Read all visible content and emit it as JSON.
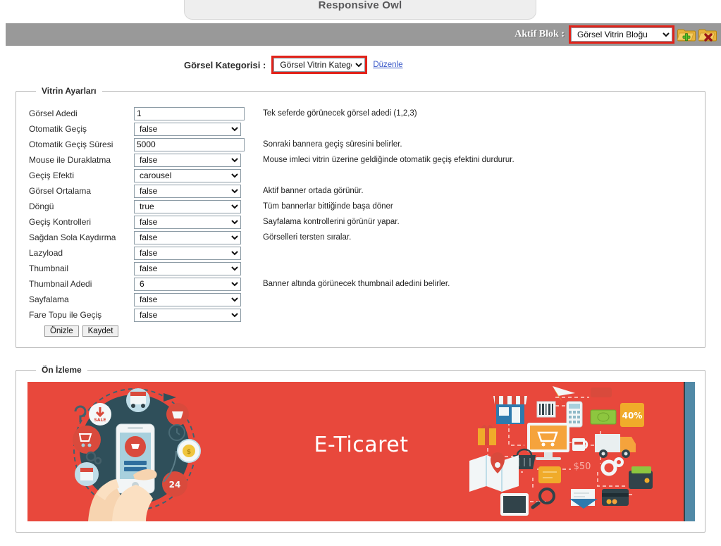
{
  "header": {
    "title": "Responsive Owl"
  },
  "toolbar": {
    "active_block_label": "Aktif Blok :",
    "active_block_value": "Görsel Vitrin Bloğu",
    "add_icon": "folder-add-icon",
    "delete_icon": "folder-delete-icon"
  },
  "category": {
    "label": "Görsel Kategorisi :",
    "value": "Görsel Vitrin Kategori",
    "edit_link": "Düzenle"
  },
  "settings": {
    "legend": "Vitrin Ayarları",
    "rows": [
      {
        "label": "Görsel Adedi",
        "type": "text",
        "value": "1",
        "desc": "Tek seferde görünecek görsel adedi (1,2,3)"
      },
      {
        "label": "Otomatik Geçiş",
        "type": "select",
        "value": "false",
        "desc": ""
      },
      {
        "label": "Otomatik Geçiş Süresi",
        "type": "text",
        "value": "5000",
        "desc": "Sonraki bannera geçiş süresini belirler."
      },
      {
        "label": "Mouse ile Duraklatma",
        "type": "select",
        "value": "false",
        "desc": "Mouse imleci vitrin üzerine geldiğinde otomatik geçiş efektini durdurur."
      },
      {
        "label": "Geçiş Efekti",
        "type": "select",
        "value": "carousel",
        "desc": ""
      },
      {
        "label": "Görsel Ortalama",
        "type": "select",
        "value": "false",
        "desc": "Aktif banner ortada görünür."
      },
      {
        "label": "Döngü",
        "type": "select",
        "value": "true",
        "desc": "Tüm bannerlar bittiğinde başa döner"
      },
      {
        "label": "Geçiş Kontrolleri",
        "type": "select",
        "value": "false",
        "desc": "Sayfalama kontrollerini görünür yapar."
      },
      {
        "label": "Sağdan Sola Kaydırma",
        "type": "select",
        "value": "false",
        "desc": "Görselleri tersten sıralar."
      },
      {
        "label": "Lazyload",
        "type": "select",
        "value": "false",
        "desc": ""
      },
      {
        "label": "Thumbnail",
        "type": "select",
        "value": "false",
        "desc": ""
      },
      {
        "label": "Thumbnail Adedi",
        "type": "select",
        "value": "6",
        "desc": "Banner altında görünecek thumbnail adedini belirler."
      },
      {
        "label": "Sayfalama",
        "type": "select",
        "value": "false",
        "desc": ""
      },
      {
        "label": "Fare Topu ile Geçiş",
        "type": "select",
        "value": "false",
        "desc": ""
      }
    ],
    "preview_button": "Önizle",
    "save_button": "Kaydet"
  },
  "preview": {
    "legend": "Ön İzleme",
    "banner_title": "E-Ticaret",
    "banner_bg": "#e8483c",
    "banner_edge": "#5189a6",
    "discount_badge": "40%",
    "price_tag": "$50",
    "sale_badge": "SALE",
    "hours_badge": "24"
  },
  "colors": {
    "toolbar_bg": "#999999",
    "highlight": "#e2231a",
    "link": "#3857c8",
    "panel_border": "#b9b9b9"
  }
}
